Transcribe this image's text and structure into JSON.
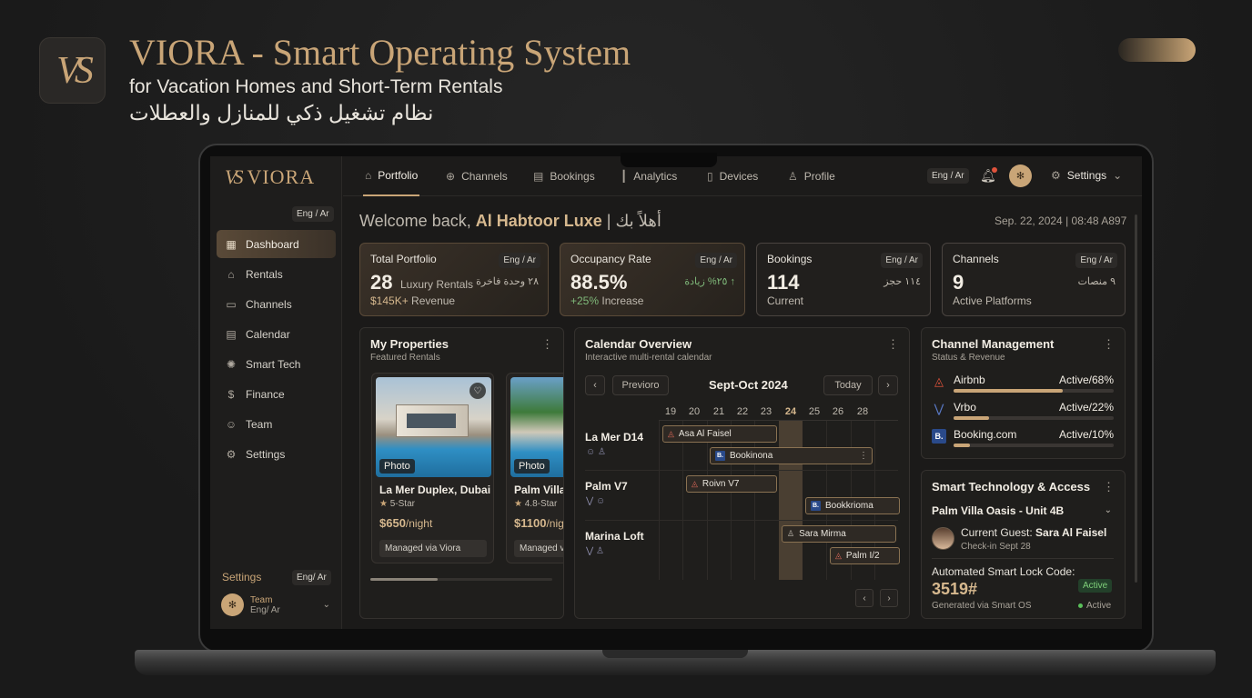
{
  "promo": {
    "logo_mark": "VS",
    "title": "VIORA - Smart Operating System",
    "subtitle": "for Vacation Homes and Short-Term Rentals",
    "subtitle_ar": "نظام تشغيل ذكي للمنازل والعطلات"
  },
  "sidebar": {
    "brand_mark": "VS",
    "brand_name": "VIORA",
    "lang": "Eng / Ar",
    "items": [
      {
        "label": "Dashboard",
        "icon": "dashboard-icon"
      },
      {
        "label": "Rentals",
        "icon": "home-icon"
      },
      {
        "label": "Channels",
        "icon": "tv-icon"
      },
      {
        "label": "Calendar",
        "icon": "calendar-icon"
      },
      {
        "label": "Smart Tech",
        "icon": "bulb-icon"
      },
      {
        "label": "Finance",
        "icon": "dollar-icon"
      },
      {
        "label": "Team",
        "icon": "users-icon"
      },
      {
        "label": "Settings",
        "icon": "gear-icon"
      }
    ],
    "footer_settings": "Settings",
    "footer_lang": "Eng/ Ar",
    "team_name": "Team",
    "team_lang": "Eng/ Ar"
  },
  "topnav": {
    "tabs": [
      {
        "label": "Portfolio",
        "icon": "home-icon"
      },
      {
        "label": "Channels",
        "icon": "globe-icon"
      },
      {
        "label": "Bookings",
        "icon": "calendar-icon"
      },
      {
        "label": "Analytics",
        "icon": "bar-chart-icon"
      },
      {
        "label": "Devices",
        "icon": "phone-icon"
      },
      {
        "label": "Profile",
        "icon": "user-icon"
      }
    ],
    "lang": "Eng / Ar",
    "settings_label": "Settings"
  },
  "welcome": {
    "prefix": "Welcome back,",
    "name": "Al Habtoor Luxe",
    "arabic": "| أهلاً بك",
    "date": "Sep. 22, 2024 | 08:48 A897"
  },
  "stats": [
    {
      "label": "Total Portfolio",
      "lang": "Eng / Ar",
      "value": "28",
      "after": "Luxury Rentals",
      "ar": "٢٨ وحدة فاخرة",
      "foot_hl": "$145K+",
      "foot": " Revenue"
    },
    {
      "label": "Occupancy Rate",
      "lang": "Eng / Ar",
      "value": "88.5%",
      "after": "",
      "ar": "↑ ٢٥% زيادة",
      "foot_hl": "+25%",
      "foot": " Increase"
    },
    {
      "label": "Bookings",
      "lang": "Eng / Ar",
      "value": "114",
      "after": "",
      "ar": "١١٤ حجز",
      "foot_hl": "",
      "foot": "Current"
    },
    {
      "label": "Channels",
      "lang": "Eng / Ar",
      "value": "9",
      "after": "",
      "ar": "٩ منصات",
      "foot_hl": "",
      "foot": "Active Platforms"
    }
  ],
  "properties": {
    "title": "My Properties",
    "subtitle": "Featured Rentals",
    "cards": [
      {
        "photo": "Photo",
        "name": "La Mer Duplex, Dubai",
        "rating": "5-Star",
        "price": "$650",
        "per": "/night",
        "managed": "Managed via Viora"
      },
      {
        "photo": "Photo",
        "name": "Palm Villa",
        "rating": "4.8-Star",
        "price": "$1100",
        "per": "/night",
        "managed": "Managed via Viora"
      }
    ]
  },
  "calendar": {
    "title": "Calendar Overview",
    "subtitle": "Interactive multi-rental calendar",
    "prev": "Previoro",
    "month": "Sept-Oct 2024",
    "today": "Today",
    "days": [
      "19",
      "20",
      "21",
      "22",
      "23",
      "24",
      "25",
      "26",
      "28"
    ],
    "rooms": [
      "La Mer D14",
      "Palm V7",
      "Marina Loft"
    ],
    "bookings": [
      {
        "label": "Asa Al Faisel"
      },
      {
        "label": "Bookinona"
      },
      {
        "label": "Roivn V7"
      },
      {
        "label": "Bookkrioma"
      },
      {
        "label": "Sara Mirma"
      },
      {
        "label": "Palm I/2"
      }
    ]
  },
  "channels": {
    "title": "Channel Management",
    "subtitle": "Status & Revenue",
    "items": [
      {
        "name": "Airbnb",
        "status": "Active/68%",
        "share": 0.68,
        "icon": "airbnb-icon",
        "color": "#e0533c"
      },
      {
        "name": "Vrbo",
        "status": "Active/22%",
        "share": 0.22,
        "icon": "vrbo-icon",
        "color": "#5a7ac8"
      },
      {
        "name": "Booking.com",
        "status": "Active/10%",
        "share": 0.1,
        "icon": "booking-icon",
        "color": "#2a4a8a"
      }
    ]
  },
  "smart": {
    "title": "Smart Technology & Access",
    "unit": "Palm Villa Oasis - Unit 4B",
    "guest_label": "Current Guest:",
    "guest_name": "Sara Al Faisel",
    "checkin": "Check-in Sept 28",
    "lock_label": "Automated Smart Lock Code:",
    "lock_code": "3519#",
    "generated": "Generated via Smart OS",
    "active_chip": "Active",
    "active_status": "Active"
  },
  "colors": {
    "accent": "#c9a577",
    "background": "#1b1a19",
    "positive": "#7fb97a"
  }
}
